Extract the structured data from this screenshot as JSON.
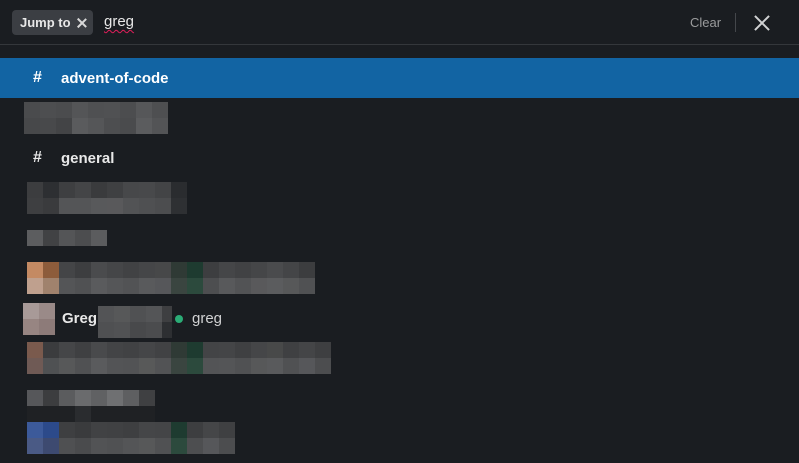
{
  "search": {
    "scope_chip_label": "Jump to",
    "query": "greg",
    "clear_label": "Clear"
  },
  "results": [
    {
      "type": "channel",
      "name": "advent-of-code",
      "selected": true
    },
    {
      "type": "channel",
      "name": "general",
      "selected": false
    },
    {
      "type": "person",
      "display_name": "Greg",
      "username": "greg",
      "status": "online"
    }
  ],
  "colors": {
    "background": "#1a1d21",
    "selected": "#1264a3",
    "presence_online": "#2bac76"
  }
}
